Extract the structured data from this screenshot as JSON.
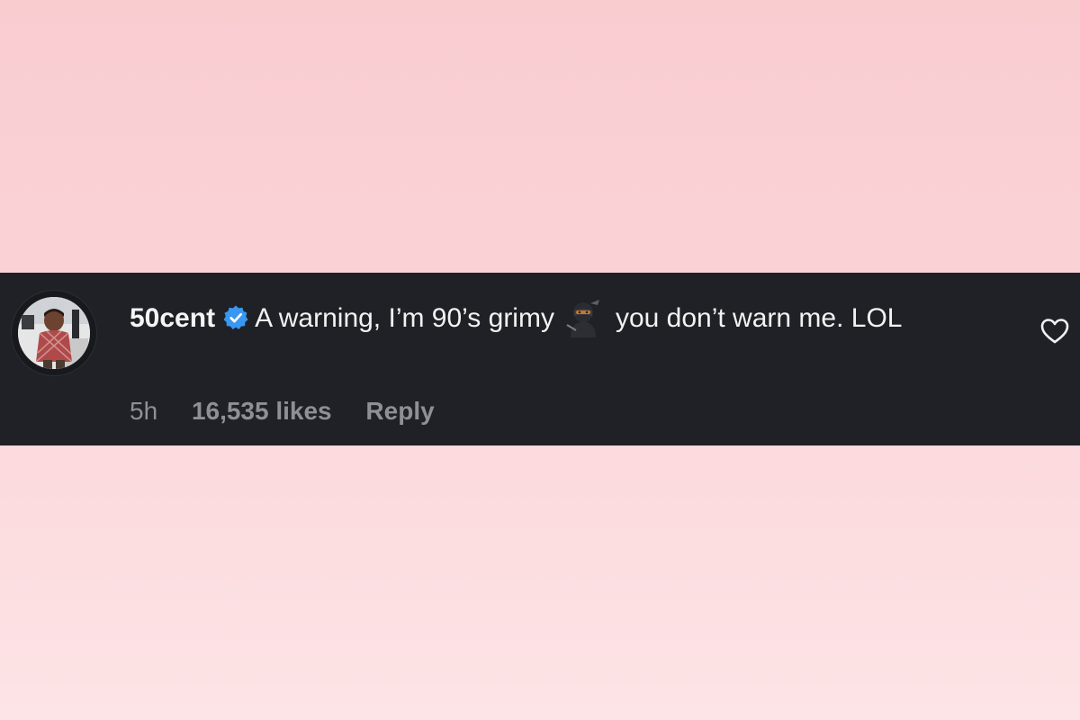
{
  "comment": {
    "username": "50cent",
    "verified": true,
    "text_part1": "A warning, I’m 90’s grimy",
    "emoji": "ninja-icon",
    "text_part2": "you don’t warn me. LOL",
    "time": "5h",
    "likes": "16,535 likes",
    "reply_label": "Reply"
  },
  "colors": {
    "card_background": "#1f2126",
    "verified_badge": "#3897f0",
    "meta_text": "#8e9096",
    "page_background_top": "#f9ccd0",
    "page_background_bottom": "#fde4e6"
  }
}
